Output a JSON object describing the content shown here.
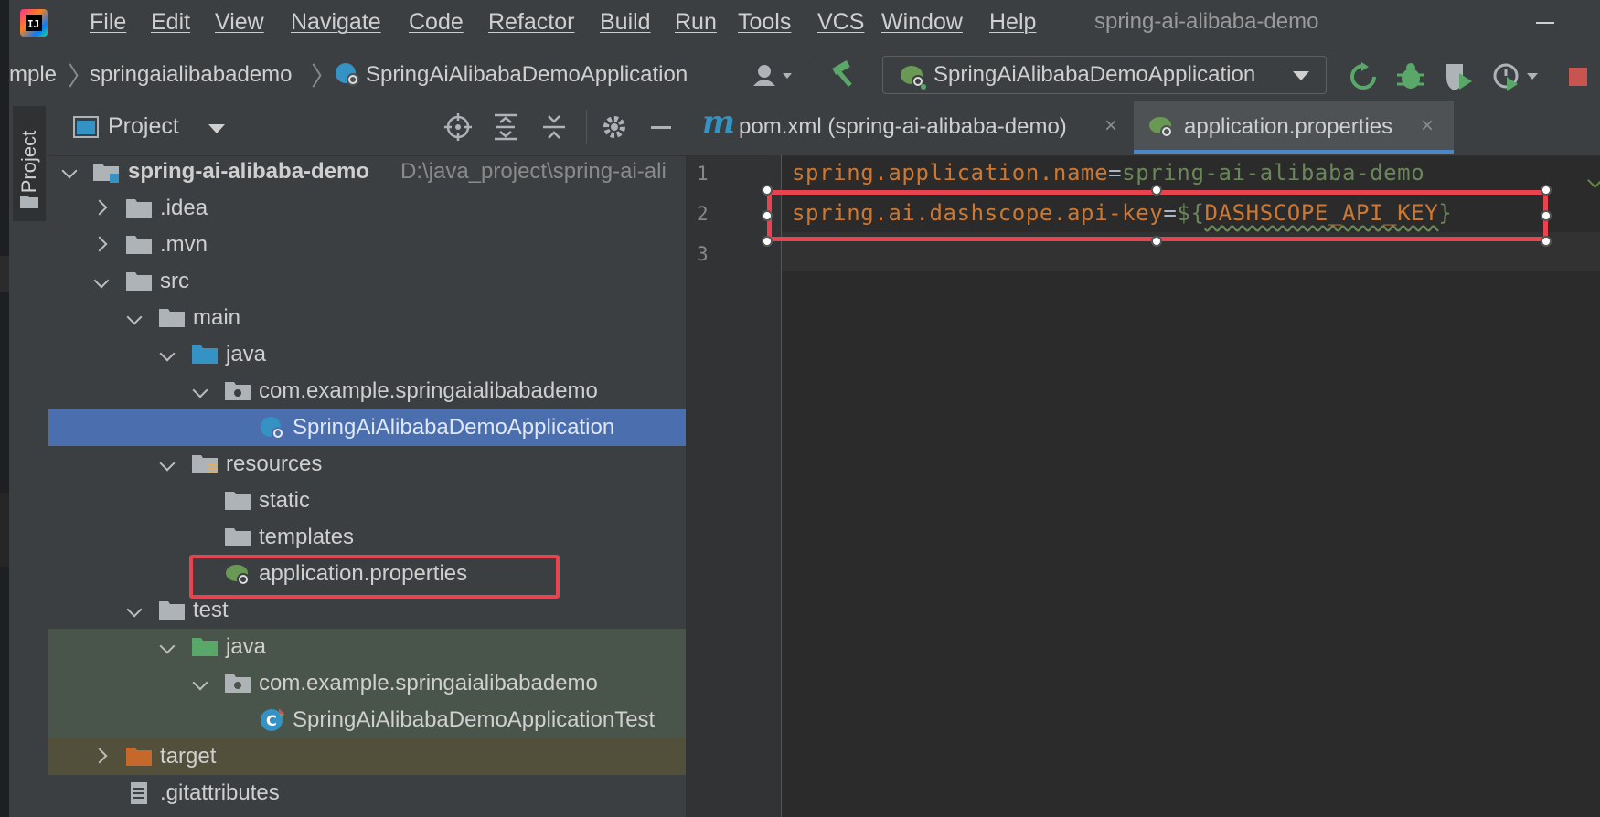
{
  "menubar": {
    "logo_text": "IJ",
    "items": [
      "File",
      "Edit",
      "View",
      "Navigate",
      "Code",
      "Refactor",
      "Build",
      "Run",
      "Tools",
      "VCS",
      "Window",
      "Help"
    ],
    "window_title": "spring-ai-alibaba-demo"
  },
  "breadcrumbs": [
    "mple",
    "springaialibabademo",
    "SpringAiAlibabaDemoApplication"
  ],
  "run_config": {
    "label": "SpringAiAlibabaDemoApplication"
  },
  "project_panel": {
    "stripe_label": "Project",
    "title": "Project",
    "tree": [
      {
        "label": "spring-ai-alibaba-demo",
        "path": "D:\\java_project\\spring-ai-ali"
      },
      {
        "label": ".idea"
      },
      {
        "label": ".mvn"
      },
      {
        "label": "src"
      },
      {
        "label": "main"
      },
      {
        "label": "java"
      },
      {
        "label": "com.example.springaialibabademo"
      },
      {
        "label": "SpringAiAlibabaDemoApplication"
      },
      {
        "label": "resources"
      },
      {
        "label": "static"
      },
      {
        "label": "templates"
      },
      {
        "label": "application.properties"
      },
      {
        "label": "test"
      },
      {
        "label": "java"
      },
      {
        "label": "com.example.springaialibabademo"
      },
      {
        "label": "SpringAiAlibabaDemoApplicationTest"
      },
      {
        "label": "target"
      },
      {
        "label": ".gitattributes"
      }
    ]
  },
  "editor": {
    "tabs": [
      {
        "icon_letter": "m",
        "label": "pom.xml (spring-ai-alibaba-demo)",
        "close": "×"
      },
      {
        "label": "application.properties",
        "close": "×"
      }
    ],
    "line_numbers": [
      "1",
      "2",
      "3"
    ],
    "lines": [
      {
        "key": "spring.application.name",
        "eq": "=",
        "value": "spring-ai-alibaba-demo"
      },
      {
        "key": "spring.ai.dashscope.api-key",
        "eq": "=",
        "value_prefix": "${",
        "var": "DASHSCOPE_API_KEY",
        "value_suffix": "}"
      }
    ]
  },
  "colors": {
    "highlight_red": "#e8434f",
    "selected_row": "#4b6eaf",
    "test_bg": "#49544a",
    "target_bg": "#52503a",
    "keyword": "#cc7832",
    "string": "#6a8759"
  }
}
